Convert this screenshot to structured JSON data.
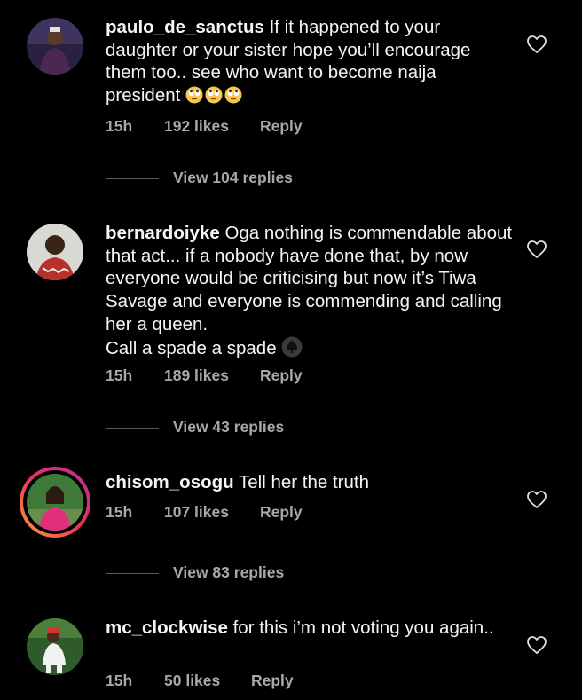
{
  "comments": [
    {
      "username": "paulo_de_sanctus",
      "text": "If it happened to your daughter or your sister hope you’ll encourage them too.. see who want to become naija president",
      "emoji": [
        "face-with-rolling-eyes",
        "face-with-rolling-eyes",
        "face-with-rolling-eyes"
      ],
      "time": "15h",
      "likes": "192 likes",
      "reply": "Reply",
      "view_replies": "View 104 replies"
    },
    {
      "username": "bernardoiyke",
      "text": "Oga nothing is commendable about that act... if a nobody have done that, by now everyone would be criticising but now it’s Tiwa Savage and everyone is commending and calling her a queen.",
      "text2": "Call a spade a spade",
      "emoji": [
        "spade-suit"
      ],
      "time": "15h",
      "likes": "189 likes",
      "reply": "Reply",
      "view_replies": "View 43 replies"
    },
    {
      "username": "chisom_osogu",
      "text": "Tell her the truth",
      "time": "15h",
      "likes": "107 likes",
      "reply": "Reply",
      "view_replies": "View 83 replies",
      "has_story": true
    },
    {
      "username": "mc_clockwise",
      "text": "for this i’m not voting you again..",
      "time": "15h",
      "likes": "50 likes",
      "reply": "Reply"
    }
  ],
  "icons": {
    "like": "heart-outline-icon"
  },
  "colors": {
    "background": "#000000",
    "text": "#f5f5f5",
    "secondary": "#a8a8a8",
    "story_ring": [
      "#f9a13a",
      "#e8325a",
      "#b22fa3"
    ]
  }
}
